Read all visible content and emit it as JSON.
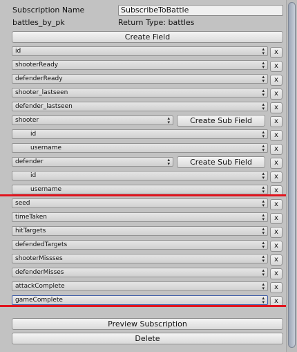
{
  "header": {
    "name_label": "Subscription Name",
    "name_value": "SubscribeToBattle",
    "pk_label": "battles_by_pk",
    "return_type": "Return Type: battles"
  },
  "create_field_label": "Create Field",
  "create_sub_field_label": "Create Sub Field",
  "remove_label": "x",
  "fields": [
    {
      "label": "id"
    },
    {
      "label": "shooterReady"
    },
    {
      "label": "defenderReady"
    },
    {
      "label": "shooter_lastseen"
    },
    {
      "label": "defender_lastseen"
    },
    {
      "label": "shooter"
    },
    {
      "label": "id"
    },
    {
      "label": "username"
    },
    {
      "label": "defender"
    },
    {
      "label": "id"
    },
    {
      "label": "username"
    },
    {
      "label": "seed"
    },
    {
      "label": "timeTaken"
    },
    {
      "label": "hitTargets"
    },
    {
      "label": "defendedTargets"
    },
    {
      "label": "shooterMissses"
    },
    {
      "label": "defenderMisses"
    },
    {
      "label": "attackComplete"
    },
    {
      "label": "gameComplete"
    }
  ],
  "footer": {
    "preview_label": "Preview Subscription",
    "delete_label": "Delete"
  },
  "colors": {
    "background": "#c2c2c2",
    "highlight_line": "#e1141e",
    "selected_border": "#3f5ea8"
  }
}
